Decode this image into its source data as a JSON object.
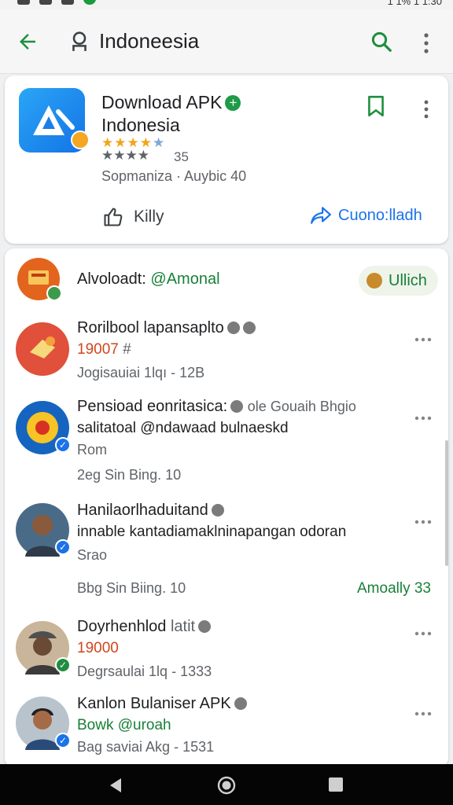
{
  "status_bar": {
    "right_text": "1 1% 1 1:30"
  },
  "app_bar": {
    "title": "Indoneesia",
    "back_icon": "arrow-left-icon",
    "profile_icon": "person-icon",
    "search_icon": "search-icon",
    "menu_icon": "more-vert-icon",
    "accent_color": "#1e8e3e"
  },
  "app_card": {
    "name_line1": "Download APK",
    "name_line2": "Indonesia",
    "rating_count": "35",
    "meta": "Sopmaniza · Auybic  40",
    "like_label": "Killy",
    "share_label": "Cuono:lladh"
  },
  "feed": {
    "header": {
      "label": "Alvoloadt:",
      "accent": "@Amonal",
      "pill_label": "Ullich"
    },
    "posts": [
      {
        "name": "Rorilbool lapansaplto",
        "line2": "19007",
        "line2_suffix": "#",
        "line3": "Jogisauiai  1lqı - 12B"
      },
      {
        "name": "Pensioad eonritasica:",
        "name_tag": "ole  Gouaih  Bhgio",
        "line2": "salitatoal @ndawaad bulnaeskd",
        "line3": "Rom",
        "line4": "2eg Sin   Bing.   10"
      },
      {
        "name": "Hanilaorlhaduitand",
        "line2": "innable kantadiamaklninapangan odoran",
        "line3": "Srao",
        "line4": "Bbg Sin   Biing.   10",
        "right": "Amoally 33"
      },
      {
        "name": "Doyrhenhlod",
        "name_suffix": "latit",
        "line2": "19000",
        "line3": "Degrsaulai  1lq - 1333"
      },
      {
        "name": "Kanlon Bulaniser APK",
        "line2": "Bowk @uroah",
        "line3": "Bag saviai  Akg - 1531"
      }
    ]
  }
}
